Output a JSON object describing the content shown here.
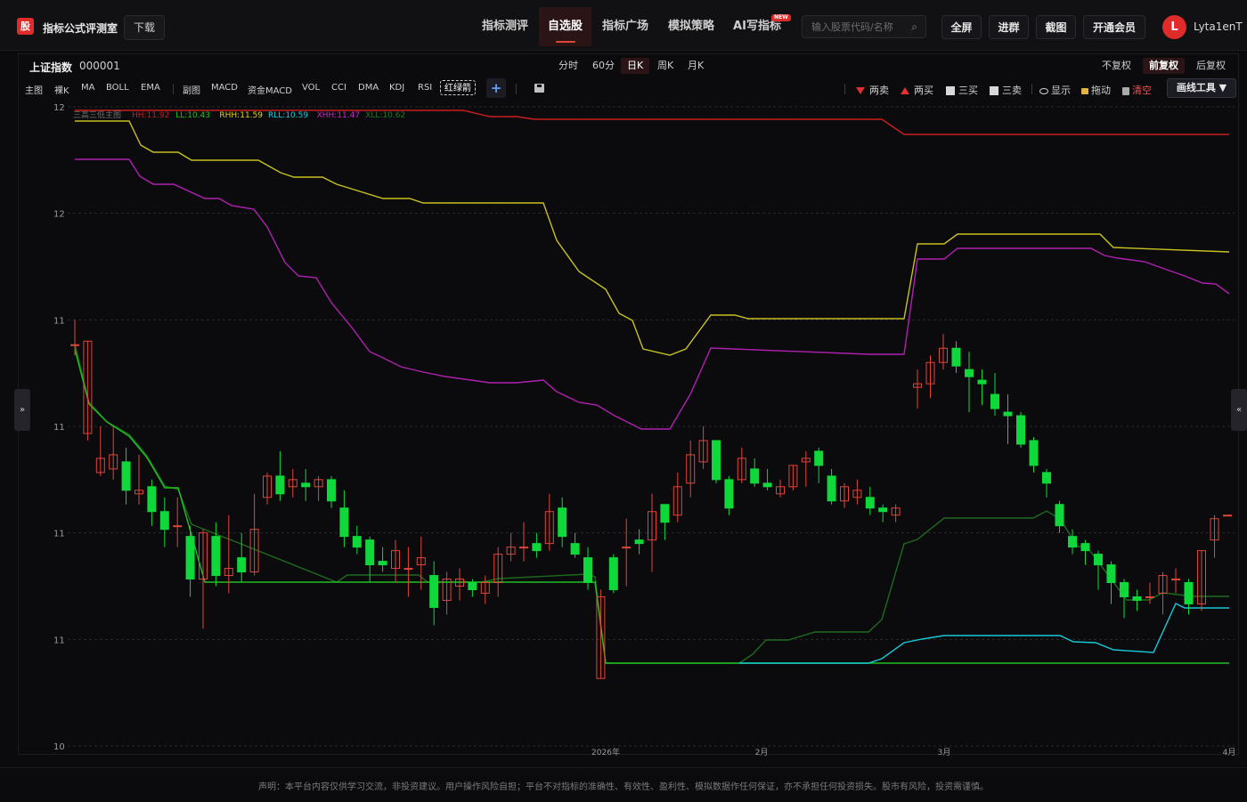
{
  "header": {
    "logo_char": "股",
    "brand": "指标公式评测室",
    "download": "下载",
    "nav": [
      {
        "label": "指标测评",
        "active": false
      },
      {
        "label": "自选股",
        "active": true
      },
      {
        "label": "指标广场",
        "active": false
      },
      {
        "label": "模拟策略",
        "active": false
      },
      {
        "label": "AI写指标",
        "active": false
      }
    ],
    "new_badge": "NEW",
    "search_placeholder": "输入股票代码/名称",
    "buttons": [
      "全屏",
      "进群",
      "截图",
      "开通会员"
    ],
    "avatar_initial": "L",
    "username": "Lyta1enT"
  },
  "stock": {
    "name": "上证指数",
    "code": "000001"
  },
  "periods": [
    {
      "label": "分时",
      "active": false
    },
    {
      "label": "60分",
      "active": false
    },
    {
      "label": "日K",
      "active": true
    },
    {
      "label": "周K",
      "active": false
    },
    {
      "label": "月K",
      "active": false
    }
  ],
  "adjust": [
    {
      "label": "不复权",
      "active": false
    },
    {
      "label": "前复权",
      "active": true
    },
    {
      "label": "后复权",
      "active": false
    }
  ],
  "tools_left": [
    "主图",
    "裸K",
    "MA",
    "BOLL",
    "EMA"
  ],
  "tools_sub": [
    "副图",
    "MACD",
    "资金MACD",
    "VOL",
    "CCI",
    "DMA",
    "KDJ",
    "RSI"
  ],
  "red_green_arrow": "红绿箭",
  "tools_right": {
    "two_sell": "两卖",
    "two_buy": "两买",
    "three_buy": "三买",
    "three_sell": "三卖",
    "show": "显示",
    "drag": "拖动",
    "clear": "清空",
    "draw_tools": "画线工具 ▼"
  },
  "side": {
    "left": "»",
    "right": "«"
  },
  "indicator": {
    "name": "三高三低主图",
    "values": [
      {
        "label": "HH:11.92",
        "color": "#c81e1e"
      },
      {
        "label": "LL:10.43",
        "color": "#22c022"
      },
      {
        "label": "RHH:11.59",
        "color": "#e0d020"
      },
      {
        "label": "RLL:10.59",
        "color": "#16d0e0"
      },
      {
        "label": "XHH:11.47",
        "color": "#d020d0"
      },
      {
        "label": "XLL:10.62",
        "color": "#1e7a1e"
      }
    ]
  },
  "chart_data": {
    "type": "candlestick",
    "y_tick_labels": [
      "12",
      "12",
      "11",
      "11",
      "11",
      "11",
      "10"
    ],
    "x_tick_labels": [
      "2026年",
      "2月",
      "3月",
      "4月"
    ],
    "grid": true,
    "candles": [
      {
        "o": 11.33,
        "c": 11.33,
        "h": 11.4,
        "l": 11.3
      },
      {
        "o": 11.08,
        "c": 11.34,
        "h": 11.34,
        "l": 11.06
      },
      {
        "o": 10.97,
        "c": 11.01,
        "h": 11.1,
        "l": 10.96
      },
      {
        "o": 10.98,
        "c": 11.02,
        "h": 11.1,
        "l": 10.95
      },
      {
        "o": 11.0,
        "c": 10.92,
        "h": 11.04,
        "l": 10.88
      },
      {
        "o": 10.91,
        "c": 10.92,
        "h": 11.02,
        "l": 10.88
      },
      {
        "o": 10.93,
        "c": 10.86,
        "h": 10.95,
        "l": 10.82
      },
      {
        "o": 10.86,
        "c": 10.81,
        "h": 10.9,
        "l": 10.76
      },
      {
        "o": 10.82,
        "c": 10.82,
        "h": 10.9,
        "l": 10.76
      },
      {
        "o": 10.79,
        "c": 10.67,
        "h": 10.82,
        "l": 10.62
      },
      {
        "o": 10.67,
        "c": 10.8,
        "h": 10.81,
        "l": 10.53
      },
      {
        "o": 10.79,
        "c": 10.68,
        "h": 10.83,
        "l": 10.65
      },
      {
        "o": 10.68,
        "c": 10.7,
        "h": 10.85,
        "l": 10.63
      },
      {
        "o": 10.73,
        "c": 10.69,
        "h": 10.8,
        "l": 10.66
      },
      {
        "o": 10.69,
        "c": 10.81,
        "h": 10.91,
        "l": 10.68
      },
      {
        "o": 10.9,
        "c": 10.96,
        "h": 10.97,
        "l": 10.88
      },
      {
        "o": 10.96,
        "c": 10.91,
        "h": 11.03,
        "l": 10.89
      },
      {
        "o": 10.93,
        "c": 10.95,
        "h": 10.98,
        "l": 10.9
      },
      {
        "o": 10.94,
        "c": 10.93,
        "h": 10.98,
        "l": 10.89
      },
      {
        "o": 10.93,
        "c": 10.95,
        "h": 10.96,
        "l": 10.89
      },
      {
        "o": 10.95,
        "c": 10.89,
        "h": 10.96,
        "l": 10.87
      },
      {
        "o": 10.87,
        "c": 10.79,
        "h": 10.92,
        "l": 10.76
      },
      {
        "o": 10.79,
        "c": 10.76,
        "h": 10.82,
        "l": 10.74
      },
      {
        "o": 10.78,
        "c": 10.71,
        "h": 10.79,
        "l": 10.66
      },
      {
        "o": 10.72,
        "c": 10.71,
        "h": 10.76,
        "l": 10.69
      },
      {
        "o": 10.7,
        "c": 10.75,
        "h": 10.78,
        "l": 10.66
      },
      {
        "o": 10.7,
        "c": 10.7,
        "h": 10.76,
        "l": 10.62
      },
      {
        "o": 10.71,
        "c": 10.73,
        "h": 10.79,
        "l": 10.64
      },
      {
        "o": 10.68,
        "c": 10.59,
        "h": 10.72,
        "l": 10.54
      },
      {
        "o": 10.61,
        "c": 10.67,
        "h": 10.69,
        "l": 10.57
      },
      {
        "o": 10.65,
        "c": 10.67,
        "h": 10.7,
        "l": 10.61
      },
      {
        "o": 10.66,
        "c": 10.64,
        "h": 10.67,
        "l": 10.62
      },
      {
        "o": 10.63,
        "c": 10.66,
        "h": 10.68,
        "l": 10.6
      },
      {
        "o": 10.66,
        "c": 10.74,
        "h": 10.76,
        "l": 10.62
      },
      {
        "o": 10.74,
        "c": 10.76,
        "h": 10.8,
        "l": 10.72
      },
      {
        "o": 10.76,
        "c": 10.76,
        "h": 10.83,
        "l": 10.72
      },
      {
        "o": 10.77,
        "c": 10.75,
        "h": 10.8,
        "l": 10.73
      },
      {
        "o": 10.77,
        "c": 10.86,
        "h": 10.91,
        "l": 10.75
      },
      {
        "o": 10.87,
        "c": 10.79,
        "h": 10.9,
        "l": 10.76
      },
      {
        "o": 10.77,
        "c": 10.74,
        "h": 10.8,
        "l": 10.73
      },
      {
        "o": 10.73,
        "c": 10.66,
        "h": 10.76,
        "l": 10.64
      },
      {
        "o": 10.39,
        "c": 10.62,
        "h": 10.64,
        "l": 10.39
      },
      {
        "o": 10.73,
        "c": 10.64,
        "h": 10.74,
        "l": 10.63
      },
      {
        "o": 10.76,
        "c": 10.76,
        "h": 10.84,
        "l": 10.65
      },
      {
        "o": 10.78,
        "c": 10.77,
        "h": 10.81,
        "l": 10.74
      },
      {
        "o": 10.78,
        "c": 10.86,
        "h": 10.91,
        "l": 10.69
      },
      {
        "o": 10.88,
        "c": 10.83,
        "h": 10.88,
        "l": 10.78
      },
      {
        "o": 10.85,
        "c": 10.93,
        "h": 10.97,
        "l": 10.83
      },
      {
        "o": 10.94,
        "c": 11.02,
        "h": 11.06,
        "l": 10.9
      },
      {
        "o": 11.0,
        "c": 11.06,
        "h": 11.1,
        "l": 10.98
      },
      {
        "o": 11.06,
        "c": 10.95,
        "h": 11.06,
        "l": 10.94
      },
      {
        "o": 10.95,
        "c": 10.87,
        "h": 10.96,
        "l": 10.85
      },
      {
        "o": 10.95,
        "c": 11.01,
        "h": 11.04,
        "l": 10.94
      },
      {
        "o": 10.98,
        "c": 10.94,
        "h": 11.01,
        "l": 10.93
      },
      {
        "o": 10.94,
        "c": 10.93,
        "h": 10.98,
        "l": 10.92
      },
      {
        "o": 10.91,
        "c": 10.93,
        "h": 10.95,
        "l": 10.9
      },
      {
        "o": 10.93,
        "c": 10.99,
        "h": 10.99,
        "l": 10.92
      },
      {
        "o": 11.0,
        "c": 11.01,
        "h": 11.03,
        "l": 10.93
      },
      {
        "o": 11.03,
        "c": 10.99,
        "h": 11.04,
        "l": 10.94
      },
      {
        "o": 10.96,
        "c": 10.89,
        "h": 10.98,
        "l": 10.88
      },
      {
        "o": 10.89,
        "c": 10.93,
        "h": 10.94,
        "l": 10.87
      },
      {
        "o": 10.9,
        "c": 10.92,
        "h": 10.95,
        "l": 10.88
      },
      {
        "o": 10.9,
        "c": 10.87,
        "h": 10.93,
        "l": 10.85
      },
      {
        "o": 10.87,
        "c": 10.86,
        "h": 10.88,
        "l": 10.83
      },
      {
        "o": 10.85,
        "c": 10.87,
        "h": 10.88,
        "l": 10.83
      },
      {
        "o": 11.21,
        "c": 11.22,
        "h": 11.26,
        "l": 11.15
      },
      {
        "o": 11.22,
        "c": 11.28,
        "h": 11.3,
        "l": 11.18
      },
      {
        "o": 11.28,
        "c": 11.32,
        "h": 11.36,
        "l": 11.26
      },
      {
        "o": 11.32,
        "c": 11.27,
        "h": 11.34,
        "l": 11.25
      },
      {
        "o": 11.26,
        "c": 11.24,
        "h": 11.31,
        "l": 11.14
      },
      {
        "o": 11.23,
        "c": 11.22,
        "h": 11.26,
        "l": 11.16
      },
      {
        "o": 11.19,
        "c": 11.15,
        "h": 11.25,
        "l": 11.13
      },
      {
        "o": 11.14,
        "c": 11.13,
        "h": 11.19,
        "l": 11.05
      },
      {
        "o": 11.13,
        "c": 11.05,
        "h": 11.14,
        "l": 11.04
      },
      {
        "o": 11.06,
        "c": 10.99,
        "h": 11.07,
        "l": 10.97
      },
      {
        "o": 10.97,
        "c": 10.94,
        "h": 10.98,
        "l": 10.9
      },
      {
        "o": 10.88,
        "c": 10.82,
        "h": 10.89,
        "l": 10.8
      },
      {
        "o": 10.79,
        "c": 10.76,
        "h": 10.81,
        "l": 10.74
      },
      {
        "o": 10.77,
        "c": 10.75,
        "h": 10.78,
        "l": 10.71
      },
      {
        "o": 10.74,
        "c": 10.71,
        "h": 10.75,
        "l": 10.64
      },
      {
        "o": 10.71,
        "c": 10.66,
        "h": 10.72,
        "l": 10.6
      },
      {
        "o": 10.66,
        "c": 10.62,
        "h": 10.67,
        "l": 10.56
      },
      {
        "o": 10.62,
        "c": 10.61,
        "h": 10.64,
        "l": 10.58
      },
      {
        "o": 10.62,
        "c": 10.62,
        "h": 10.66,
        "l": 10.6
      },
      {
        "o": 10.63,
        "c": 10.68,
        "h": 10.69,
        "l": 10.57
      },
      {
        "o": 10.67,
        "c": 10.67,
        "h": 10.7,
        "l": 10.63
      },
      {
        "o": 10.66,
        "c": 10.6,
        "h": 10.67,
        "l": 10.57
      },
      {
        "o": 10.6,
        "c": 10.75,
        "h": 10.75,
        "l": 10.58
      },
      {
        "o": 10.78,
        "c": 10.84,
        "h": 10.85,
        "l": 10.73
      },
      {
        "o": 10.85,
        "c": 10.85,
        "h": 10.85,
        "l": 10.85
      }
    ]
  },
  "disclaimer": "声明：本平台内容仅供学习交流，非投资建议。用户操作风险自担；平台不对指标的准确性、有效性、盈利性、模拟数据作任何保证，亦不承担任何投资损失。股市有风险，投资需谨慎。"
}
